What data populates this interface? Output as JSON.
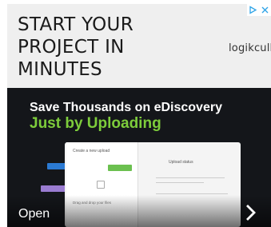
{
  "ad": {
    "headline_lines": [
      "START YOUR",
      "PROJECT IN",
      "MINUTES"
    ],
    "brand": "logikcull",
    "icons": {
      "adchoices": "adchoices-icon",
      "close": "close-icon",
      "chevron": "chevron-right-icon"
    },
    "colors": {
      "header_bg": "#efefef",
      "image_bg": "#14161a",
      "accent_green": "#7dcc3b",
      "adchoices_blue": "#2fa4e7"
    }
  },
  "promo": {
    "title": "Save Thousands on eDiscovery",
    "subtitle": "Just by Uploading",
    "mockup": {
      "dialog_title": "Create a new upload",
      "upload_hint": "Drag and drop your files",
      "panel_title": "Upload status"
    }
  },
  "cta": {
    "label": "Open"
  }
}
